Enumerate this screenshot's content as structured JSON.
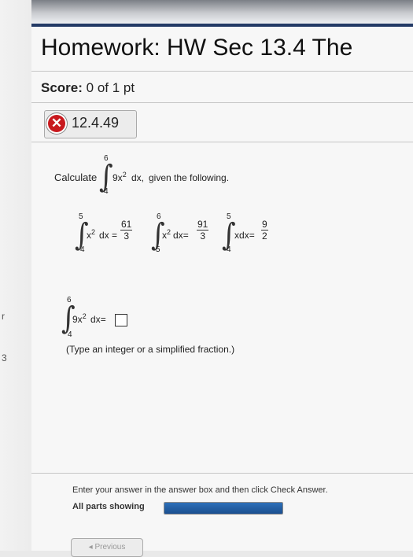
{
  "header": {
    "title": "Homework: HW Sec 13.4 The"
  },
  "score": {
    "label": "Score:",
    "value": "0 of 1 pt"
  },
  "question": {
    "id": "12.4.49",
    "status": "incorrect",
    "prompt_before": "Calculate",
    "main_integral": {
      "lower": "4",
      "upper": "6",
      "integrand": "9x",
      "exp": "2",
      "dx": "dx,"
    },
    "prompt_after": "given the following.",
    "given": [
      {
        "lower": "4",
        "upper": "5",
        "integrand": "x",
        "exp": "2",
        "dx": "dx",
        "eq": "=",
        "num": "61",
        "den": "3"
      },
      {
        "lower": "5",
        "upper": "6",
        "integrand": "x",
        "exp": "2",
        "dx": "dx",
        "eq": "=",
        "num": "91",
        "den": "3"
      },
      {
        "lower": "4",
        "upper": "5",
        "integrand": "xdx",
        "exp": "",
        "dx": "",
        "eq": "=",
        "num": "9",
        "den": "2"
      }
    ],
    "answer": {
      "lower": "4",
      "upper": "6",
      "integrand": "9x",
      "exp": "2",
      "dx": "dx",
      "eq": "=",
      "value": ""
    },
    "hint": "(Type an integer or a simplified fraction.)"
  },
  "footer": {
    "instruction": "Enter your answer in the answer box and then click Check Answer.",
    "parts_label": "All parts showing",
    "progress_fraction": 1.0,
    "prev_button": "◂ Previous"
  },
  "colors": {
    "accent": "#233a66",
    "error": "#c8191e",
    "progress": "#1b4f8f"
  },
  "page_edge": {
    "glyph_1": "r",
    "glyph_2": "3"
  }
}
